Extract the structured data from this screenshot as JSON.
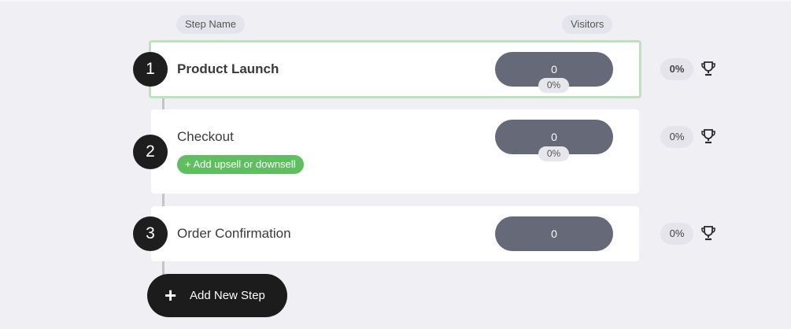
{
  "header": {
    "step_name": "Step Name",
    "visitors": "Visitors"
  },
  "steps": [
    {
      "number": "1",
      "name": "Product Launch",
      "visitors": "0",
      "conversion": "0%",
      "rate": "0%",
      "active": true
    },
    {
      "number": "2",
      "name": "Checkout",
      "visitors": "0",
      "conversion": "0%",
      "rate": "0%",
      "add_upsell_label": "+ Add upsell or downsell"
    },
    {
      "number": "3",
      "name": "Order Confirmation",
      "visitors": "0",
      "rate": "0%"
    }
  ],
  "add_step": {
    "icon": "+",
    "label": "Add New Step"
  },
  "colors": {
    "active_border": "#bfe0bd",
    "upsell_green": "#5fbe60",
    "visitors_pill": "#666a78",
    "dark": "#1e1e1e"
  }
}
